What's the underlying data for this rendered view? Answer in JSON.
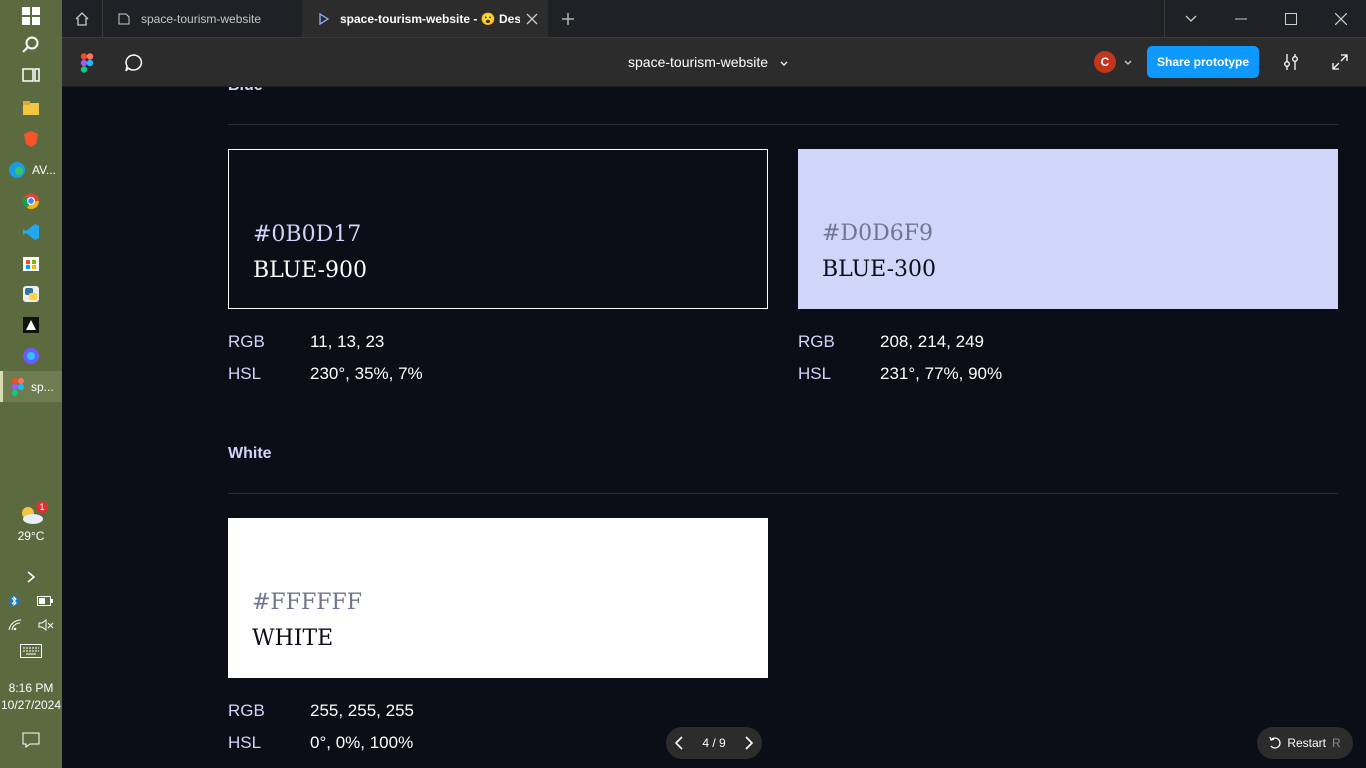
{
  "taskbar": {
    "apps": [
      {
        "icon": "windows-start-icon"
      },
      {
        "icon": "search-icon"
      },
      {
        "icon": "task-view-icon"
      },
      {
        "icon": "file-explorer-icon"
      },
      {
        "icon": "brave-icon"
      },
      {
        "icon": "edge-icon",
        "label": "AV..."
      },
      {
        "icon": "chrome-icon"
      },
      {
        "icon": "vscode-icon"
      },
      {
        "icon": "store-icon"
      },
      {
        "icon": "python-icon"
      },
      {
        "icon": "app-icon"
      },
      {
        "icon": "copilot-icon"
      },
      {
        "icon": "figma-icon",
        "label": "sp..."
      }
    ],
    "weather": {
      "temp": "29°C",
      "badge": "1"
    },
    "clock": {
      "time": "8:16 PM",
      "date": "10/27/2024"
    }
  },
  "browser": {
    "tabs": [
      {
        "label": "space-tourism-website",
        "icon": "figma-file-icon"
      },
      {
        "label": "space-tourism-website - 😮 Des",
        "icon": "play-icon",
        "active": true
      }
    ]
  },
  "toolbar": {
    "file_title": "space-tourism-website",
    "avatar_initial": "C",
    "share_label": "Share prototype"
  },
  "page": {
    "sections": [
      {
        "title": "Blue"
      },
      {
        "title": "White"
      }
    ],
    "swatches": [
      {
        "hex": "#0B0D17",
        "name": "BLUE-900",
        "rgb": "11, 13, 23",
        "hsl": "230°, 35%, 7%",
        "bg": "#0B0D17",
        "fg": "#FFFFFF",
        "hexcolor": "#D0D6F9"
      },
      {
        "hex": "#D0D6F9",
        "name": "BLUE-300",
        "rgb": "208, 214, 249",
        "hsl": "231°, 77%, 90%",
        "bg": "#D0D6F9",
        "fg": "#0B0D17",
        "hexcolor": "#717591"
      },
      {
        "hex": "#FFFFFF",
        "name": "WHITE",
        "rgb": "255, 255, 255",
        "hsl": "0°, 0%, 100%",
        "bg": "#FFFFFF",
        "fg": "#0B0D17",
        "hexcolor": "#717591"
      }
    ],
    "labels": {
      "rgb": "RGB",
      "hsl": "HSL"
    },
    "pager": "4 / 9",
    "restart": {
      "label": "Restart",
      "shortcut": "R"
    }
  }
}
